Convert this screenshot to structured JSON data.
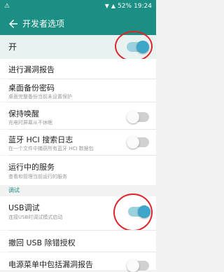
{
  "status": {
    "left": "⚠",
    "wifi": "▼",
    "signal": "▲",
    "battery": "52%",
    "time": "19:24"
  },
  "appbar": {
    "title": "开发者选项"
  },
  "master": {
    "label": "开",
    "on": true
  },
  "rows": [
    {
      "title": "进行漏洞报告",
      "subtitle": ""
    },
    {
      "title": "桌面备份密码",
      "subtitle": "桌面完整备份当前未设置保护"
    },
    {
      "title": "保持唤醒",
      "subtitle": "充电时屏幕从不休眠"
    },
    {
      "title": "蓝牙 HCI 搜索日志",
      "subtitle": "在一个文件中捕获所有蓝牙 HCI 数据包"
    },
    {
      "title": "运行中的服务",
      "subtitle": "查看和管理当前运行的服务"
    }
  ],
  "section_label": "调试",
  "debug_rows": [
    {
      "title": "USB调试",
      "subtitle": "连接USB时调试模式启动",
      "on": true
    },
    {
      "title": "撤回 USB 除错授权",
      "subtitle": ""
    },
    {
      "title": "电源菜单中包括漏洞报告",
      "subtitle": ""
    }
  ]
}
